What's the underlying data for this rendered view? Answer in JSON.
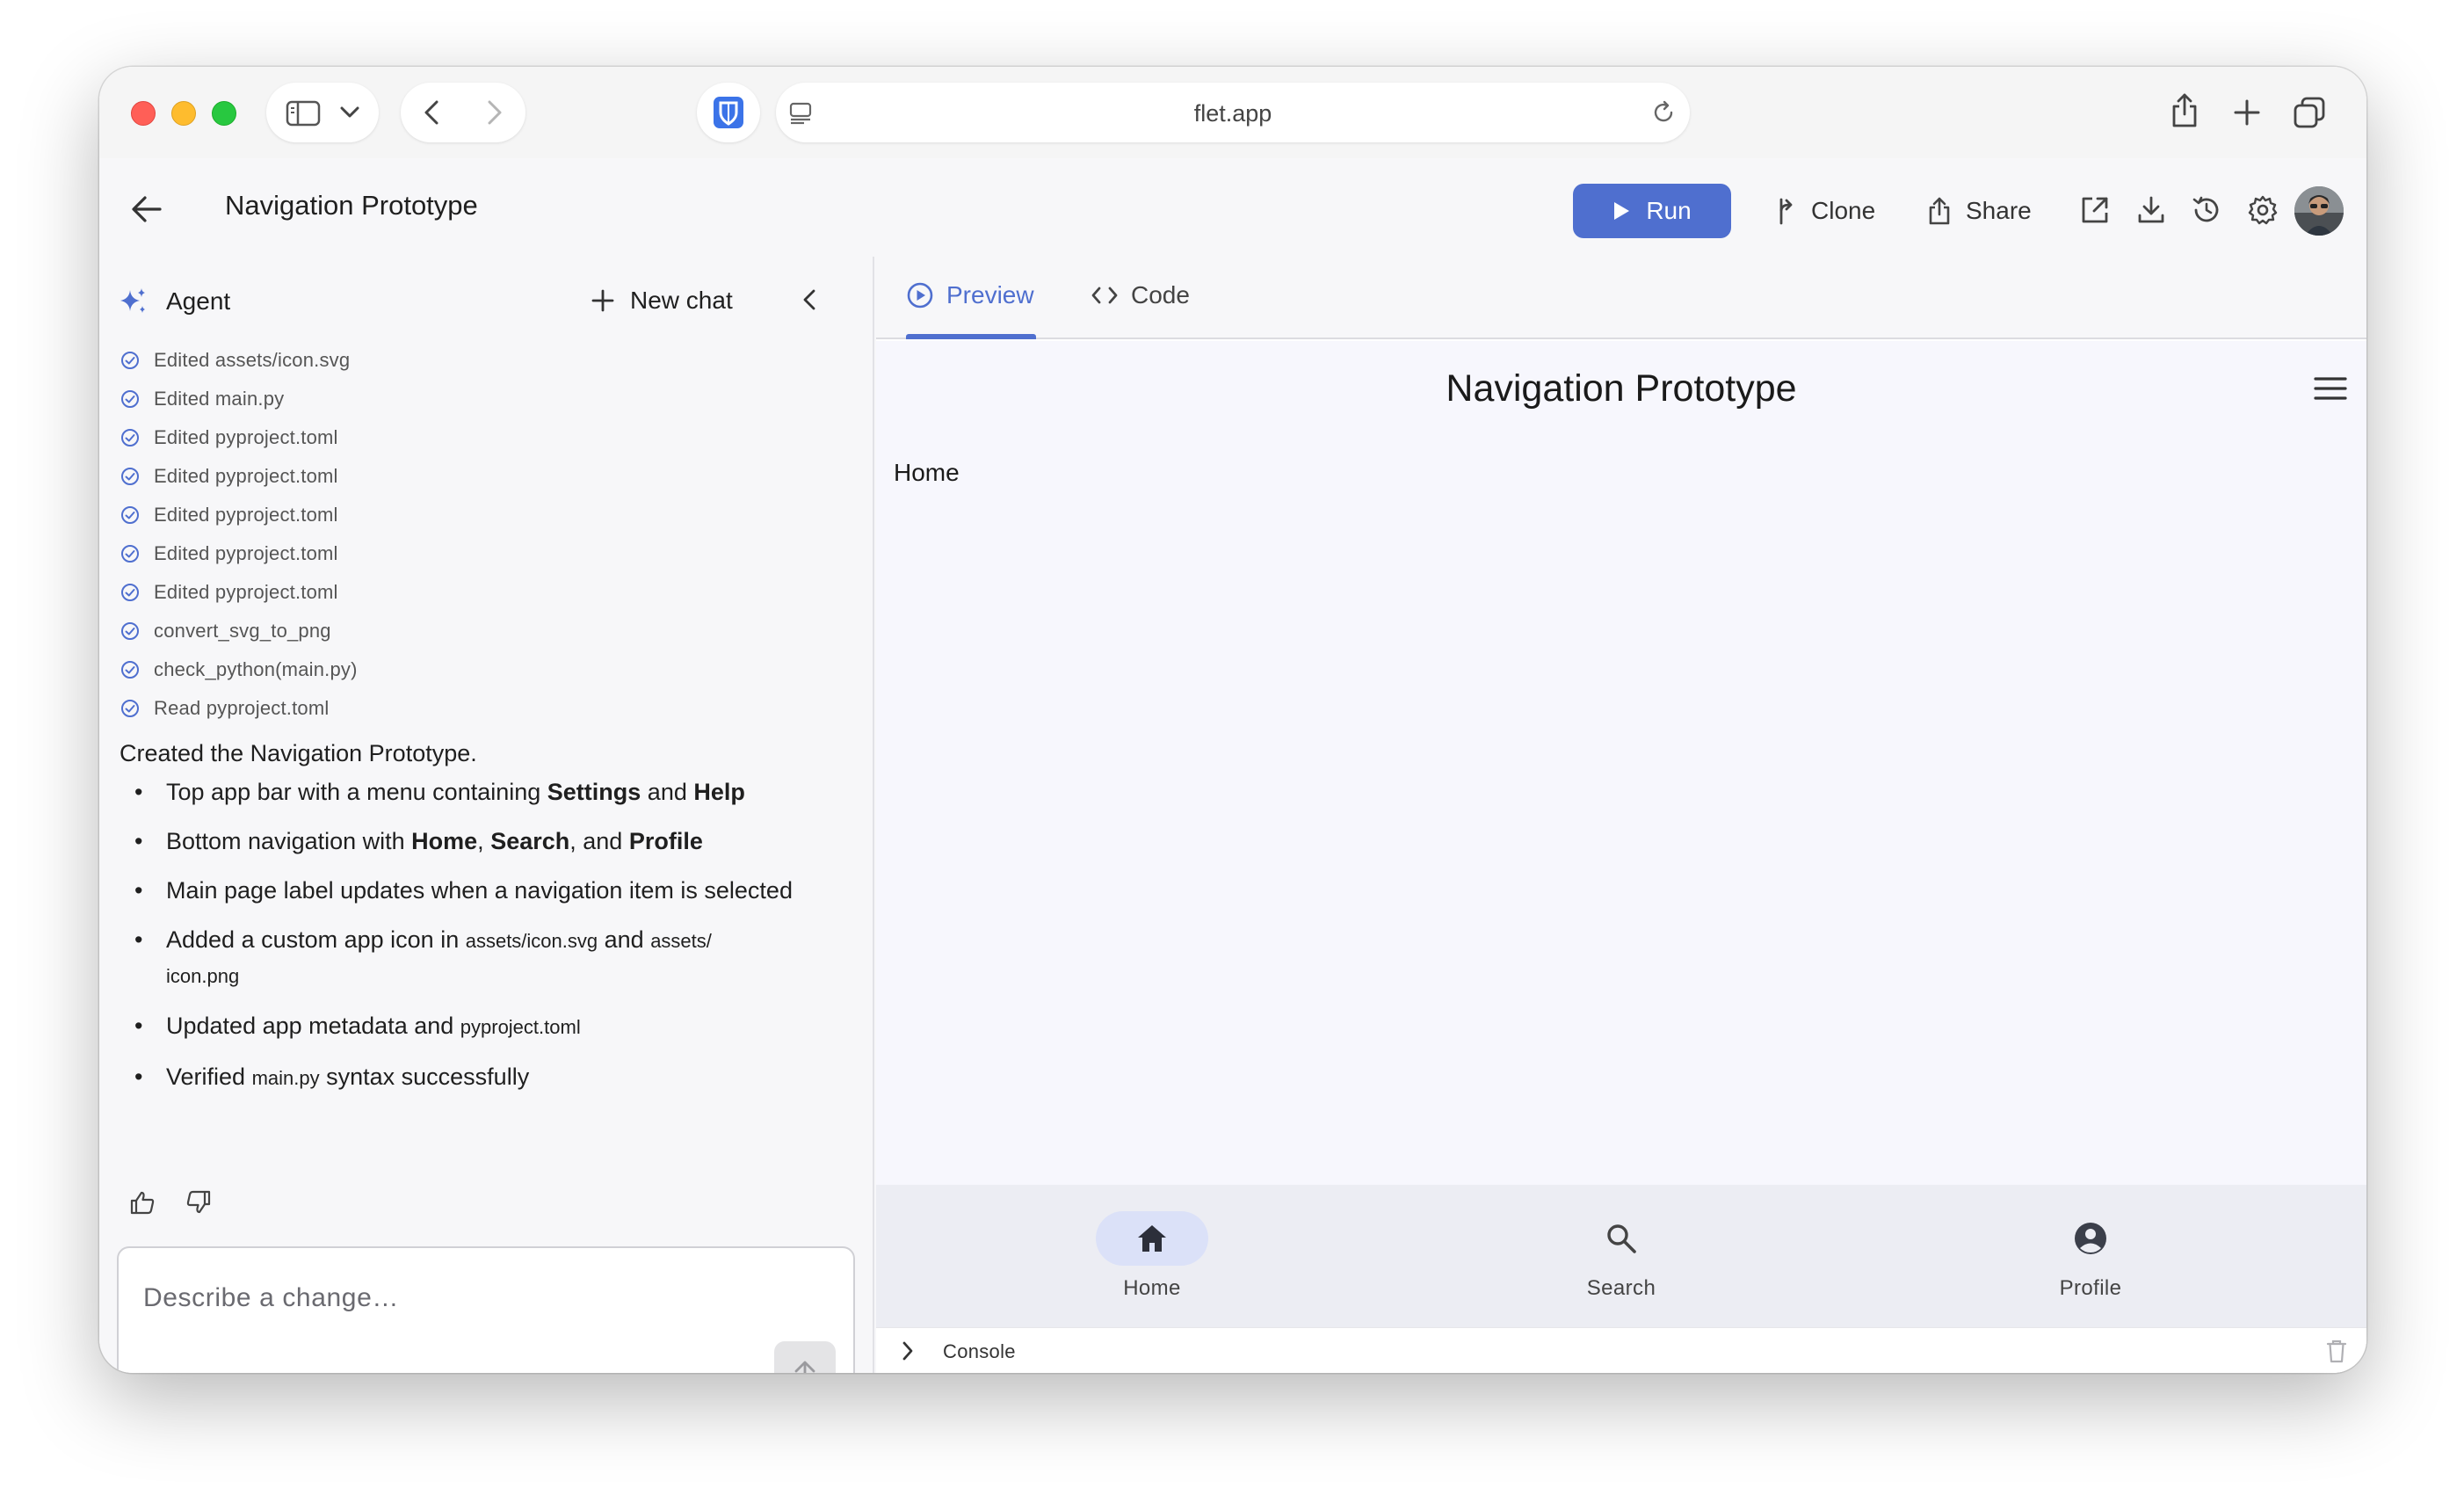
{
  "browser": {
    "url": "flet.app"
  },
  "header": {
    "title": "Navigation Prototype",
    "run_label": "Run",
    "clone_label": "Clone",
    "share_label": "Share"
  },
  "agent": {
    "title": "Agent",
    "new_chat_label": "New chat",
    "steps": [
      "Edited assets/icon.svg",
      "Edited main.py",
      "Edited pyproject.toml",
      "Edited pyproject.toml",
      "Edited pyproject.toml",
      "Edited pyproject.toml",
      "Edited pyproject.toml",
      "convert_svg_to_png",
      "check_python(main.py)",
      "Read pyproject.toml"
    ],
    "summary": "Created the Navigation Prototype.",
    "bullets": {
      "b1": {
        "t1": "Top app bar with a menu containing ",
        "b1": "Settings",
        "t2": " and ",
        "b2": "Help"
      },
      "b2": {
        "t1": "Bottom navigation with ",
        "b1": "Home",
        "t2": ", ",
        "b2": "Search",
        "t3": ", and ",
        "b3": "Profile"
      },
      "b3": {
        "t1": "Main page label updates when a navigation item is selected"
      },
      "b4": {
        "t1": "Added a custom app icon in ",
        "c1": "assets/icon.svg",
        "t2": " and ",
        "c2": "assets/",
        "c3": "icon.png"
      },
      "b5": {
        "t1": "Updated app metadata and ",
        "c1": "pyproject.toml"
      },
      "b6": {
        "t1": "Verified ",
        "c1": "main.py",
        "t2": " syntax successfully"
      }
    },
    "composer_placeholder": "Describe a change…"
  },
  "preview": {
    "tabs": [
      "Preview",
      "Code"
    ],
    "active_tab": "Preview",
    "app_title": "Navigation Prototype",
    "page_label": "Home",
    "nav_items": [
      "Home",
      "Search",
      "Profile"
    ],
    "selected_nav": "Home",
    "console_label": "Console"
  },
  "colors": {
    "accent": "#4f6fcf",
    "nav_indicator": "#dbe1f8",
    "bottom_nav_bg": "#ecedf3"
  }
}
